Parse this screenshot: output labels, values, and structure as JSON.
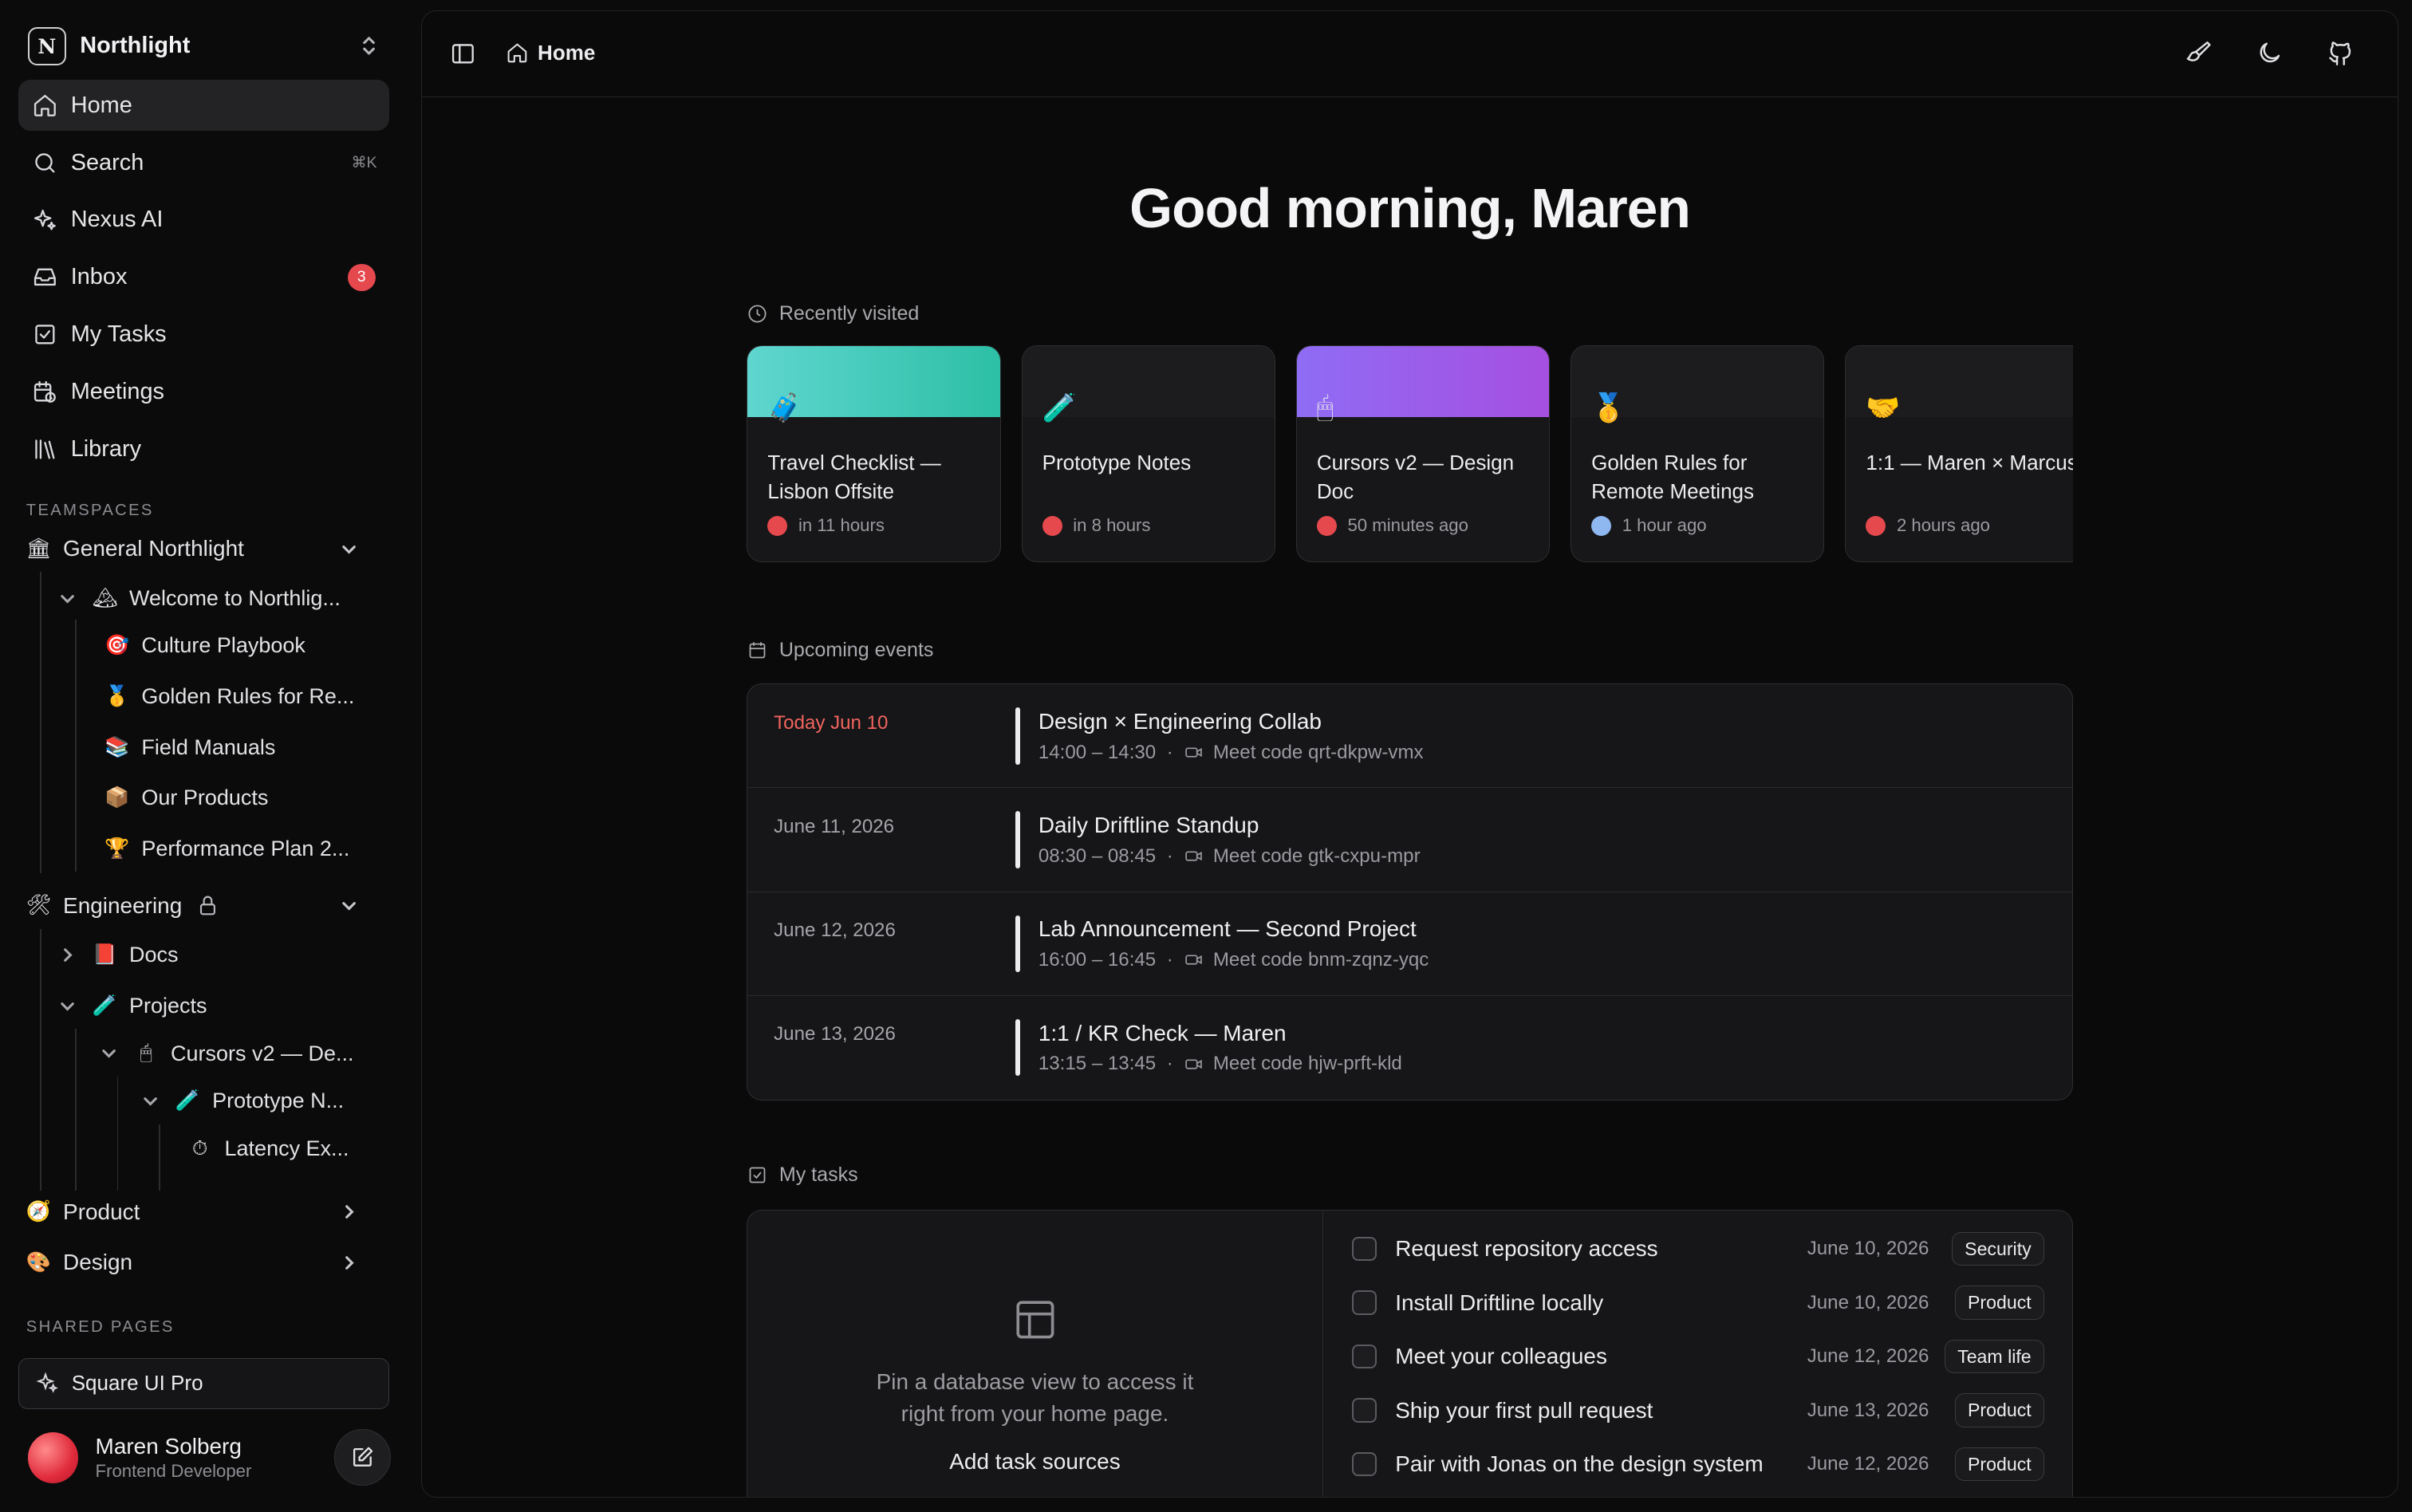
{
  "workspace": {
    "logo": "N",
    "name": "Northlight"
  },
  "nav": [
    {
      "label": "Home",
      "icon": "home-icon"
    },
    {
      "label": "Search",
      "icon": "search-icon",
      "shortcut": "⌘K"
    },
    {
      "label": "Nexus AI",
      "icon": "sparkle-icon"
    },
    {
      "label": "Inbox",
      "icon": "inbox-icon",
      "badge": "3"
    },
    {
      "label": "My Tasks",
      "icon": "check-square-icon"
    },
    {
      "label": "Meetings",
      "icon": "calendar-clock-icon"
    },
    {
      "label": "Library",
      "icon": "library-icon"
    }
  ],
  "teamspaces_label": "TEAMSPACES",
  "tree": {
    "general": {
      "emoji": "🏛",
      "label": "General Northlight"
    },
    "welcome": {
      "emoji": "🏔",
      "label": "Welcome to Northlig..."
    },
    "culture": {
      "emoji": "🎯",
      "label": "Culture Playbook"
    },
    "golden": {
      "emoji": "🥇",
      "label": "Golden Rules for Re..."
    },
    "field": {
      "emoji": "📚",
      "label": "Field Manuals"
    },
    "products": {
      "emoji": "📦",
      "label": "Our Products"
    },
    "performance": {
      "emoji": "🏆",
      "label": "Performance Plan 2..."
    },
    "engineering": {
      "emoji": "🛠",
      "label": "Engineering"
    },
    "docs": {
      "emoji": "📕",
      "label": "Docs"
    },
    "projects": {
      "emoji": "🧪",
      "label": "Projects"
    },
    "cursors": {
      "emoji": "🖱",
      "label": "Cursors v2 — De..."
    },
    "prototype": {
      "emoji": "🧪",
      "label": "Prototype N..."
    },
    "latency": {
      "emoji": "⏱",
      "label": "Latency Ex..."
    },
    "product": {
      "emoji": "🧭",
      "label": "Product"
    },
    "design": {
      "emoji": "🎨",
      "label": "Design"
    }
  },
  "shared_label": "SHARED PAGES",
  "shared": {
    "label": "Square UI Pro",
    "icon": "sparkle-icon"
  },
  "user": {
    "name": "Maren Solberg",
    "role": "Frontend Developer"
  },
  "breadcrumb": {
    "label": "Home"
  },
  "greeting": "Good morning, Maren",
  "recent": {
    "heading": "Recently visited",
    "cards": [
      {
        "title": "Travel Checklist — Lisbon Offsite",
        "emoji": "🧳",
        "time": "in 11 hours",
        "banner": "#3ecfc4",
        "avatar": "#e5484d"
      },
      {
        "title": "Prototype Notes",
        "emoji": "🧪",
        "time": "in 8 hours",
        "banner": "",
        "avatar": "#e5484d"
      },
      {
        "title": "Cursors v2 — Design Doc",
        "emoji": "🖱",
        "time": "50 minutes ago",
        "banner": "#8b5cf6",
        "avatar": "#e5484d"
      },
      {
        "title": "Golden Rules for Remote Meetings",
        "emoji": "🥇",
        "time": "1 hour ago",
        "banner": "",
        "avatar": "#8fb8f0"
      },
      {
        "title": "1:1 — Maren × Marcus",
        "emoji": "🤝",
        "time": "2 hours ago",
        "banner": "",
        "avatar": "#e5484d"
      }
    ]
  },
  "events": {
    "heading": "Upcoming events",
    "items": [
      {
        "date": "Today Jun 10",
        "today": true,
        "title": "Design × Engineering Collab",
        "time": "14:00 – 14:30",
        "code": "Meet code qrt-dkpw-vmx"
      },
      {
        "date": "June 11, 2026",
        "title": "Daily Driftline Standup",
        "time": "08:30 – 08:45",
        "code": "Meet code gtk-cxpu-mpr"
      },
      {
        "date": "June 12, 2026",
        "title": "Lab Announcement — Second Project",
        "time": "16:00 – 16:45",
        "code": "Meet code bnm-zqnz-yqc"
      },
      {
        "date": "June 13, 2026",
        "title": "1:1 / KR Check — Maren",
        "time": "13:15 – 13:45",
        "code": "Meet code hjw-prft-kld"
      }
    ]
  },
  "tasks": {
    "heading": "My tasks",
    "empty_text": "Pin a database view to access it right from your home page.",
    "add_sources": "Add task sources",
    "items": [
      {
        "name": "Request repository access",
        "date": "June 10, 2026",
        "tag": "Security"
      },
      {
        "name": "Install Driftline locally",
        "date": "June 10, 2026",
        "tag": "Product"
      },
      {
        "name": "Meet your colleagues",
        "date": "June 12, 2026",
        "tag": "Team life"
      },
      {
        "name": "Ship your first pull request",
        "date": "June 13, 2026",
        "tag": "Product"
      },
      {
        "name": "Pair with Jonas on the design system",
        "date": "June 12, 2026",
        "tag": "Product"
      }
    ]
  }
}
